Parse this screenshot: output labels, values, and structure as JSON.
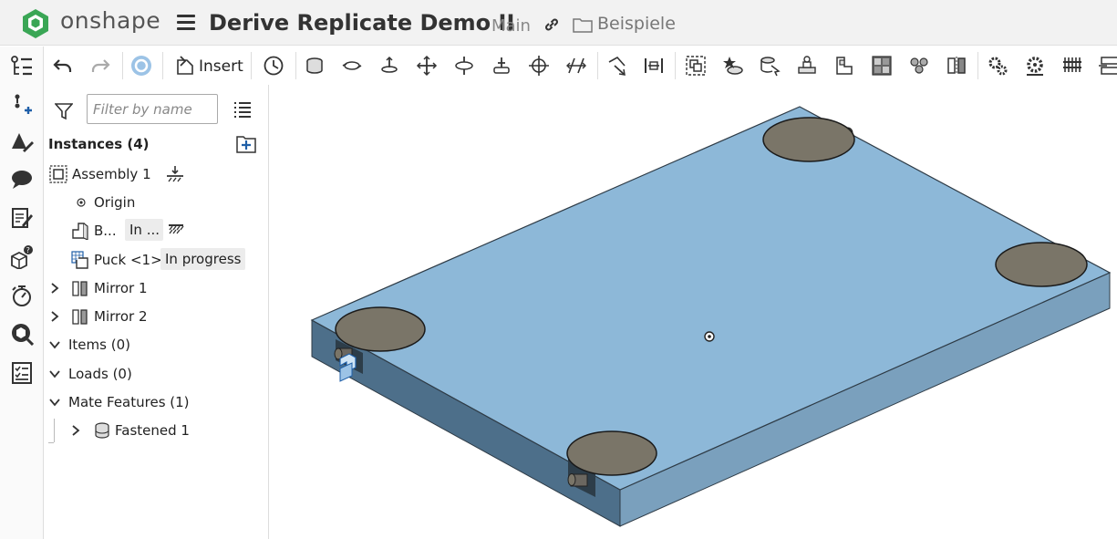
{
  "header": {
    "brand": "onshape",
    "title": "Derive Replicate Demo II",
    "workspace": "Main",
    "folder": "Beispiele"
  },
  "toolbar": {
    "insert_label": "Insert"
  },
  "panel": {
    "filter_placeholder": "Filter by name",
    "instances_label": "Instances (4)",
    "tree": {
      "assembly": "Assembly 1",
      "origin": "Origin",
      "part_b": "B...",
      "part_b_status": "In ...",
      "puck": "Puck <1>",
      "puck_status": "In progress",
      "mirror1": "Mirror 1",
      "mirror2": "Mirror 2",
      "items": "Items (0)",
      "loads": "Loads (0)",
      "mate_features": "Mate Features (1)",
      "fastened": "Fastened 1"
    }
  },
  "colors": {
    "plate_top": "#8db8d8",
    "plate_front": "#4d6f8a",
    "plate_side": "#7aa0bd",
    "puck": "#7a7568",
    "accent_blue": "#1f5fa8",
    "logo_green": "#3aa655"
  }
}
